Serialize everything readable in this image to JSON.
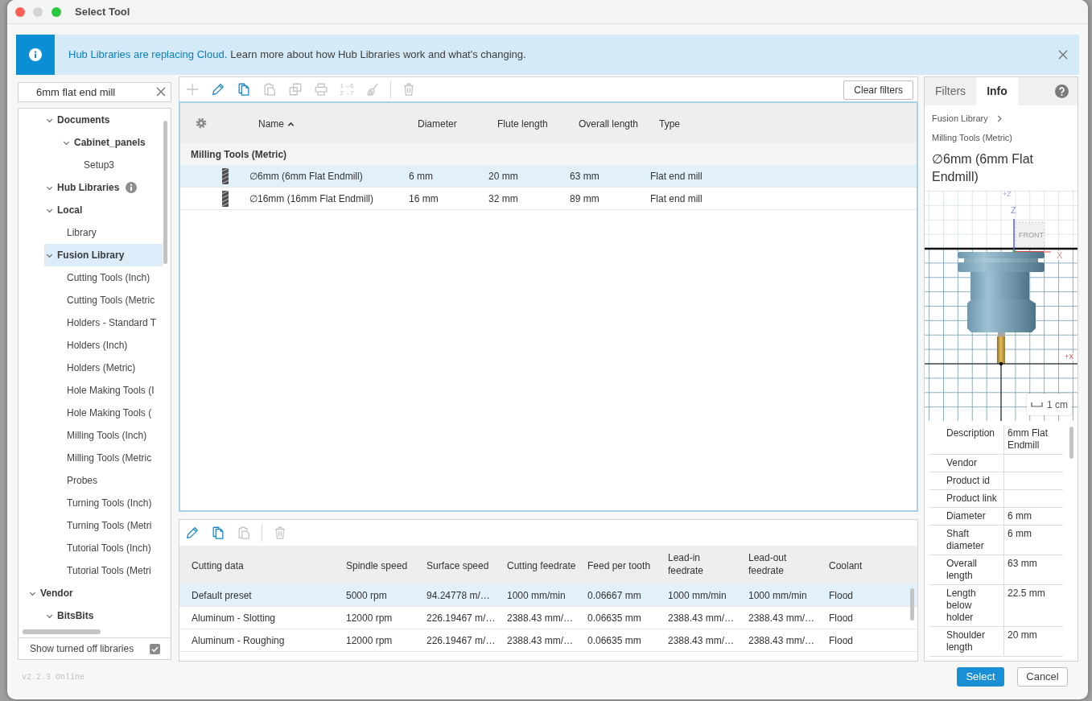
{
  "window": {
    "title": "Select Tool"
  },
  "banner": {
    "link": "Hub Libraries are replacing Cloud.",
    "text": "Learn more about how Hub Libraries work and what's changing."
  },
  "library_panel": {
    "search": {
      "value": "6mm flat end mill"
    },
    "tree": [
      {
        "expanded": true,
        "children": [
          {
            "label": "Documents",
            "expanded": true,
            "selected": false,
            "children": [
              {
                "label": "Cabinet_panels",
                "expanded": true,
                "selected": false,
                "children": [
                  {
                    "label": "Setup3",
                    "selected": false
                  }
                ]
              }
            ]
          },
          {
            "label": "Hub Libraries",
            "expanded": true,
            "selected": false,
            "info": true
          },
          {
            "label": "Local",
            "expanded": true,
            "selected": false,
            "children": [
              {
                "label": "Library",
                "selected": false
              }
            ]
          },
          {
            "label": "Fusion Library",
            "expanded": true,
            "selected": true,
            "children": [
              {
                "label": "Cutting Tools (Inch)",
                "selected": false
              },
              {
                "label": "Cutting Tools (Metric",
                "selected": false
              },
              {
                "label": "Holders - Standard T",
                "selected": false
              },
              {
                "label": "Holders (Inch)",
                "selected": false
              },
              {
                "label": "Holders (Metric)",
                "selected": false
              },
              {
                "label": "Hole Making Tools (I",
                "selected": false
              },
              {
                "label": "Hole Making Tools (",
                "selected": false
              },
              {
                "label": "Milling Tools (Inch)",
                "selected": false
              },
              {
                "label": "Milling Tools (Metric",
                "selected": false
              },
              {
                "label": "Probes",
                "selected": false
              },
              {
                "label": "Turning Tools (Inch)",
                "selected": false
              },
              {
                "label": "Turning Tools (Metri",
                "selected": false
              },
              {
                "label": "Tutorial Tools (Inch)",
                "selected": false
              },
              {
                "label": "Tutorial Tools (Metri",
                "selected": false
              }
            ]
          }
        ]
      },
      {
        "label": "Vendor",
        "expanded": true,
        "selected": false,
        "children": [
          {
            "label": "BitsBits",
            "expanded": true,
            "selected": false
          }
        ]
      }
    ],
    "show_turned_off_libraries": {
      "label": "Show turned off libraries",
      "checked": true
    }
  },
  "tools_toolbar": {
    "buttons": [
      {
        "kind": "add",
        "disabled": true
      },
      {
        "kind": "edit",
        "disabled": false
      },
      {
        "kind": "copy",
        "disabled": false
      },
      {
        "kind": "paste",
        "disabled": true
      },
      {
        "kind": "duplicate",
        "disabled": true
      },
      {
        "kind": "print",
        "disabled": true
      },
      {
        "kind": "renumber",
        "disabled": true,
        "lines": [
          "1→6",
          "2→7"
        ]
      },
      {
        "kind": "clear",
        "disabled": true
      },
      {
        "kind": "separator"
      },
      {
        "kind": "delete",
        "disabled": true
      }
    ],
    "clear_filters": "Clear filters"
  },
  "tools_table": {
    "columns": [
      {
        "label": "Name",
        "sorted": true,
        "ascending": true
      },
      {
        "label": "Diameter"
      },
      {
        "label": "Flute length"
      },
      {
        "label": "Overall length"
      },
      {
        "label": "Type"
      }
    ],
    "groups": [
      {
        "label": "Milling Tools (Metric)",
        "rows": [
          {
            "selected": true,
            "cells": [
              "∅6mm (6mm Flat Endmill)",
              "6 mm",
              "20 mm",
              "63 mm",
              "Flat end mill"
            ]
          },
          {
            "selected": false,
            "cells": [
              "∅16mm (16mm Flat Endmill)",
              "16 mm",
              "32 mm",
              "89 mm",
              "Flat end mill"
            ]
          }
        ]
      }
    ]
  },
  "presets_toolbar": {
    "buttons": [
      {
        "kind": "edit",
        "disabled": false
      },
      {
        "kind": "copy",
        "disabled": false
      },
      {
        "kind": "paste",
        "disabled": true
      },
      {
        "kind": "separator"
      },
      {
        "kind": "delete",
        "disabled": true
      }
    ]
  },
  "presets_table": {
    "columns": [
      "Cutting data",
      "Spindle speed",
      "Surface speed",
      "Cutting feedrate",
      "Feed per tooth",
      "Lead-in feedrate",
      "Lead-out feedrate",
      "Coolant"
    ],
    "rows": [
      {
        "selected": true,
        "cells": [
          "Default preset",
          "5000 rpm",
          "94.24778 m/…",
          "1000 mm/min",
          "0.06667 mm",
          "1000 mm/min",
          "1000 mm/min",
          "Flood"
        ]
      },
      {
        "selected": false,
        "cells": [
          "Aluminum - Slotting",
          "12000 rpm",
          "226.19467 m/…",
          "2388.43 mm/…",
          "0.06635 mm",
          "2388.43 mm/…",
          "2388.43 mm/…",
          "Flood"
        ]
      },
      {
        "selected": false,
        "cells": [
          "Aluminum - Roughing",
          "12000 rpm",
          "226.19467 m/…",
          "2388.43 mm/…",
          "0.06635 mm",
          "2388.43 mm/…",
          "2388.43 mm/…",
          "Flood"
        ]
      }
    ]
  },
  "info_panel": {
    "tabs": [
      {
        "label": "Filters",
        "selected": false
      },
      {
        "label": "Info",
        "selected": true
      }
    ],
    "breadcrumb": [
      "Fusion Library",
      "Milling Tools (Metric)"
    ],
    "title": "∅6mm (6mm Flat Endmill)",
    "preview": {
      "labels": [
        "+Z",
        "Z",
        "FRONT",
        "X",
        "+X"
      ],
      "scale": "1 cm"
    },
    "properties": [
      {
        "label": "Description",
        "value": "6mm Flat Endmill"
      },
      {
        "label": "Vendor"
      },
      {
        "label": "Product id"
      },
      {
        "label": "Product link"
      },
      {
        "label": "Diameter",
        "value": "6 mm"
      },
      {
        "label": "Shaft diameter",
        "value": "6 mm"
      },
      {
        "label": "Overall length",
        "value": "63 mm"
      },
      {
        "label": "Length below holder",
        "value": "22.5 mm"
      },
      {
        "label": "Shoulder length",
        "value": "20 mm"
      }
    ]
  },
  "footer": {
    "version": "v2.2.3 Online",
    "buttons": [
      {
        "label": "Select",
        "kind": "primary"
      },
      {
        "label": "Cancel",
        "kind": "secondary"
      }
    ]
  }
}
